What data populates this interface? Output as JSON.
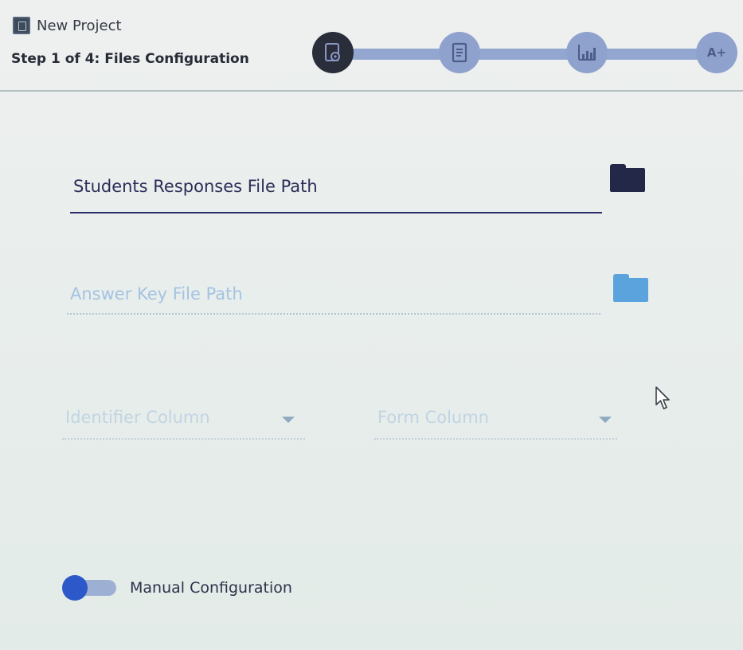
{
  "window": {
    "title": "New Project",
    "app_icon": "app-icon"
  },
  "header": {
    "step_label": "Step 1 of 4: Files Configuration"
  },
  "stepper": {
    "steps": [
      {
        "icon": "file-settings-icon",
        "active": true
      },
      {
        "icon": "document-icon",
        "active": false
      },
      {
        "icon": "bar-chart-icon",
        "active": false
      },
      {
        "label": "A+",
        "icon": "grade-icon",
        "active": false
      }
    ],
    "colors": {
      "active": "#2a2e3a",
      "inactive": "#8fa2cd",
      "track": "#93a6d0"
    }
  },
  "form": {
    "students_file_path": {
      "placeholder": "Students Responses File Path",
      "icon": "folder-icon"
    },
    "answer_key_file_path": {
      "placeholder": "Answer Key File Path",
      "icon": "folder-icon",
      "disabled": true
    },
    "identifier_column": {
      "placeholder": "Identifier Column",
      "icon": "chevron-down-icon",
      "disabled": true
    },
    "form_column": {
      "placeholder": "Form Column",
      "icon": "chevron-down-icon",
      "disabled": true
    }
  },
  "manual_configuration": {
    "label": "Manual Configuration",
    "enabled": true,
    "accent": "#2d58c9"
  }
}
